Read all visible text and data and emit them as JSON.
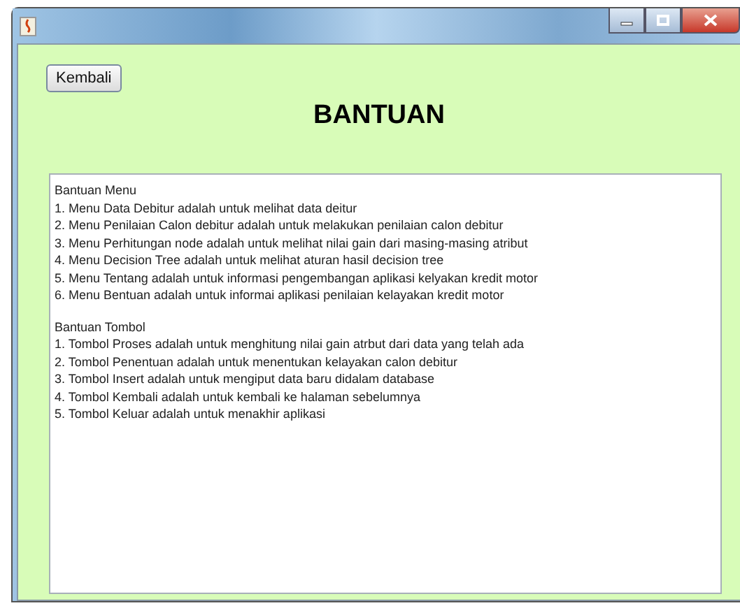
{
  "back_button": {
    "label": "Kembali"
  },
  "heading": "BANTUAN",
  "help_sections": [
    {
      "title": "Bantuan Menu",
      "lines": [
        "1. Menu Data Debitur adalah untuk melihat data deitur",
        "2. Menu Penilaian Calon debitur adalah untuk melakukan penilaian calon debitur",
        "3. Menu Perhitungan node adalah untuk melihat nilai gain dari masing-masing atribut",
        "4. Menu Decision Tree adalah untuk melihat aturan hasil decision tree",
        "5. Menu Tentang adalah untuk informasi pengembangan aplikasi kelyakan kredit motor",
        "6. Menu Bentuan adalah untuk informai aplikasi penilaian kelayakan kredit motor"
      ]
    },
    {
      "title": "Bantuan Tombol",
      "lines": [
        "1. Tombol Proses adalah untuk menghitung nilai gain atrbut dari data yang telah ada",
        "2. Tombol Penentuan adalah untuk menentukan kelayakan calon debitur",
        "3. Tombol Insert adalah untuk mengiput data baru didalam database",
        "4. Tombol Kembali adalah untuk kembali ke halaman sebelumnya",
        "5. Tombol Keluar adalah untuk menakhir aplikasi"
      ]
    }
  ]
}
